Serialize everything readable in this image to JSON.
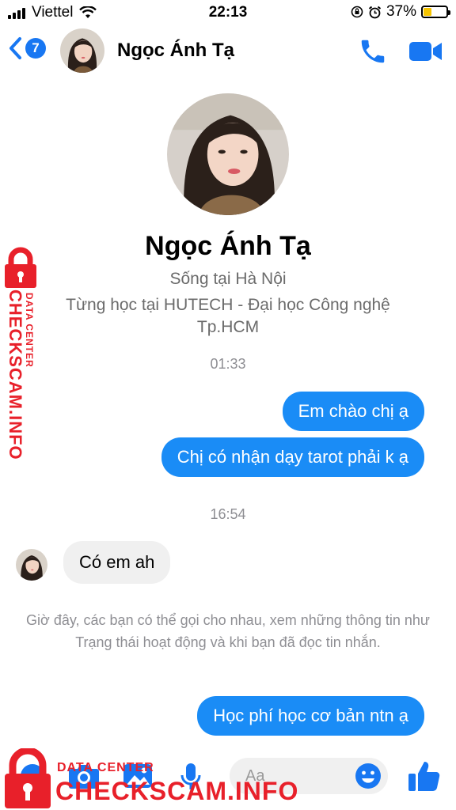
{
  "status_bar": {
    "carrier": "Viettel",
    "time": "22:13",
    "battery_percent": "37%",
    "battery_level": 0.37
  },
  "header": {
    "unread_count": "7",
    "contact_name": "Ngọc Ánh Tạ"
  },
  "profile": {
    "name": "Ngọc Ánh Tạ",
    "lives_in": "Sống tại Hà Nội",
    "studied_at": "Từng học tại HUTECH - Đại học Công nghệ Tp.HCM"
  },
  "messages": {
    "timestamp_1": "01:33",
    "out_1": "Em chào chị ạ",
    "out_2": "Chị có nhận dạy tarot phải k ạ",
    "timestamp_2": "16:54",
    "in_1": "Có em ah",
    "notice": "Giờ đây, các bạn có thể gọi cho nhau, xem những thông tin như Trạng thái hoạt động và khi bạn đã đọc tin nhắn.",
    "out_3": "Học phí học cơ bản ntn ạ"
  },
  "composer": {
    "placeholder": "Aa"
  },
  "watermark": {
    "line1": "DATA CENTER",
    "line2": "CHECKSCAM.INFO"
  },
  "colors": {
    "accent": "#1877f2",
    "bubble_out": "#1a8cf6",
    "bubble_in": "#f0f0f0",
    "watermark": "#e8202a"
  },
  "icons": [
    "wifi-icon",
    "back-chevron-icon",
    "call-icon",
    "video-call-icon",
    "camera-icon",
    "image-icon",
    "microphone-icon",
    "emoji-icon",
    "like-icon",
    "lock-icon"
  ]
}
